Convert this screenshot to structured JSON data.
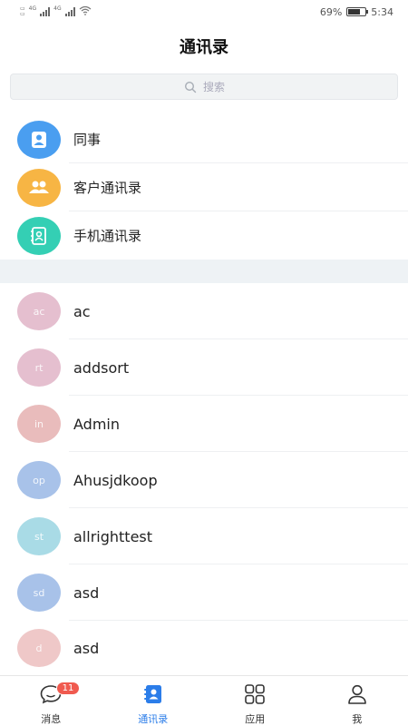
{
  "status_bar": {
    "network": "4G",
    "battery_percent": "69%",
    "battery_level": 0.69,
    "time": "5:34"
  },
  "header": {
    "title": "通讯录"
  },
  "search": {
    "placeholder": "搜索"
  },
  "groups": [
    {
      "label": "同事",
      "icon": "person-icon",
      "color": "#4a9ef0"
    },
    {
      "label": "客户通讯录",
      "icon": "group-icon",
      "color": "#f7b544"
    },
    {
      "label": "手机通讯录",
      "icon": "contact-book-icon",
      "color": "#34cfb4"
    }
  ],
  "contacts": [
    {
      "initials": "ac",
      "name": "ac",
      "color": "#e5bfcf"
    },
    {
      "initials": "rt",
      "name": "addsort",
      "color": "#e5bfcf"
    },
    {
      "initials": "in",
      "name": "Admin",
      "color": "#e9bcbc"
    },
    {
      "initials": "op",
      "name": "Ahusjdkoop",
      "color": "#a8c2e9"
    },
    {
      "initials": "st",
      "name": "allrighttest",
      "color": "#a9dbe6"
    },
    {
      "initials": "sd",
      "name": "asd",
      "color": "#a8c2e9"
    },
    {
      "initials": "d",
      "name": "asd",
      "color": "#efc8c8"
    }
  ],
  "tabbar": {
    "tabs": [
      {
        "label": "消息",
        "icon": "chat-bubble-icon",
        "badge": "11"
      },
      {
        "label": "通讯录",
        "icon": "contacts-icon",
        "active": true
      },
      {
        "label": "应用",
        "icon": "apps-grid-icon"
      },
      {
        "label": "我",
        "icon": "profile-icon"
      }
    ],
    "active_color": "#2b7de9"
  }
}
